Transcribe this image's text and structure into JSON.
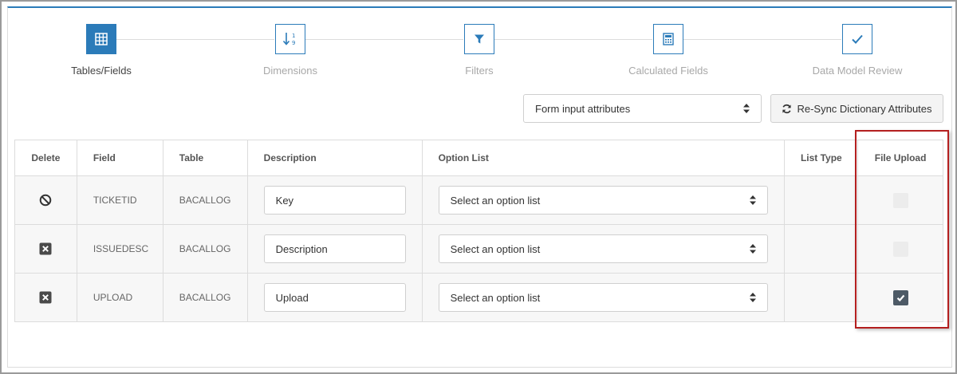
{
  "stepper": {
    "steps": [
      {
        "label": "Tables/Fields",
        "icon": "table-grid-icon",
        "active": true
      },
      {
        "label": "Dimensions",
        "icon": "sort-numeric-icon",
        "active": false
      },
      {
        "label": "Filters",
        "icon": "filter-icon",
        "active": false
      },
      {
        "label": "Calculated Fields",
        "icon": "calculator-icon",
        "active": false
      },
      {
        "label": "Data Model Review",
        "icon": "checkmark-icon",
        "active": false
      }
    ]
  },
  "toolbar": {
    "attribute_select": "Form input attributes",
    "resync_label": "Re-Sync Dictionary Attributes"
  },
  "table": {
    "headers": {
      "delete": "Delete",
      "field": "Field",
      "table": "Table",
      "description": "Description",
      "option_list": "Option List",
      "list_type": "List Type",
      "file_upload": "File Upload"
    },
    "rows": [
      {
        "delete_icon": "blocked-icon",
        "field": "TICKETID",
        "table": "BACALLOG",
        "description": "Key",
        "option_list": "Select an option list",
        "list_type": "",
        "file_upload": false
      },
      {
        "delete_icon": "delete-x-icon",
        "field": "ISSUEDESC",
        "table": "BACALLOG",
        "description": "Description",
        "option_list": "Select an option list",
        "list_type": "",
        "file_upload": false
      },
      {
        "delete_icon": "delete-x-icon",
        "field": "UPLOAD",
        "table": "BACALLOG",
        "description": "Upload",
        "option_list": "Select an option list",
        "list_type": "",
        "file_upload": true
      }
    ]
  },
  "colors": {
    "accent": "#2b7bb9",
    "highlight": "#b41f1f",
    "checkbox_checked": "#4d5a66"
  }
}
